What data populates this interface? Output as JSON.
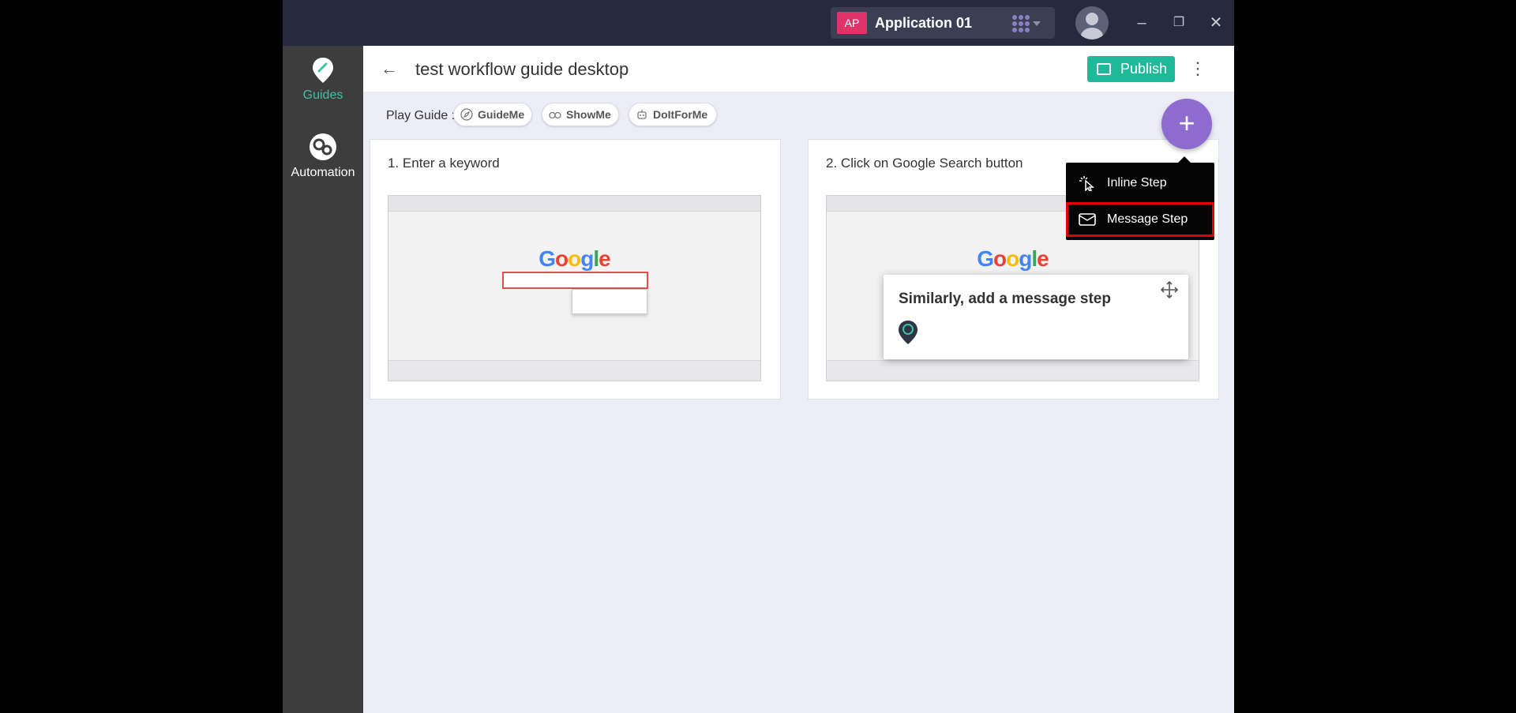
{
  "titlebar": {
    "app_badge": "AP",
    "app_name": "Application 01",
    "minimize_glyph": "–",
    "restore_glyph": "❐",
    "close_glyph": "✕"
  },
  "rail": {
    "items": [
      {
        "label": "Guides",
        "icon": "guides-pin-icon",
        "active": true
      },
      {
        "label": "Automation",
        "icon": "automation-gears-icon",
        "active": false
      }
    ]
  },
  "header": {
    "back_glyph": "←",
    "title": "test workflow guide desktop",
    "publish_label": "Publish",
    "more_glyph": "⋮"
  },
  "play_guide": {
    "label": "Play Guide :",
    "modes": [
      "GuideMe",
      "ShowMe",
      "DoItForMe"
    ]
  },
  "steps": [
    {
      "number": "1.",
      "title": "Enter a keyword"
    },
    {
      "number": "2.",
      "title": "Click on Google Search button"
    }
  ],
  "fab_glyph": "+",
  "add_menu": {
    "items": [
      {
        "label": "Inline Step",
        "icon": "cursor-click-icon"
      },
      {
        "label": "Message Step",
        "icon": "envelope-icon",
        "highlighted": true
      }
    ]
  },
  "message_popup": {
    "text": "Similarly, add a message step"
  },
  "colors": {
    "accent_green": "#1fb99a",
    "fab_purple": "#8e6ccf",
    "highlight_red": "#e00000"
  }
}
